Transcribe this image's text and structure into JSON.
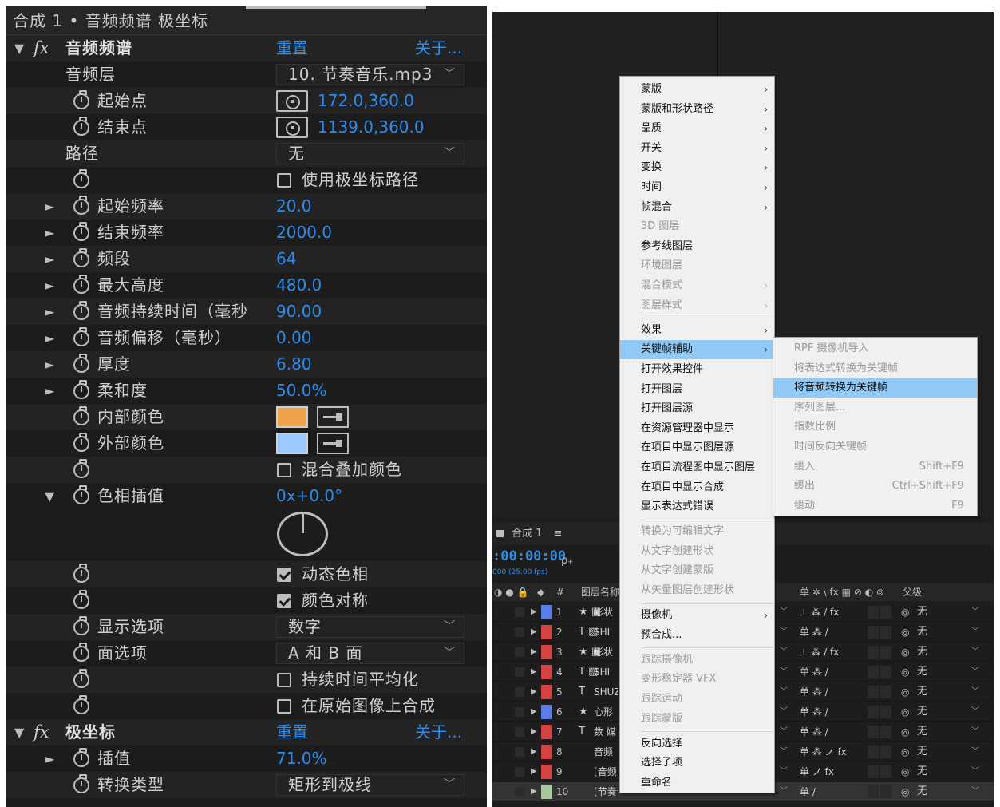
{
  "left_panel": {
    "title": "合成 1 • 音频频谱 极坐标",
    "effect1": {
      "name": "音频频谱",
      "reset": "重置",
      "about": "关于..."
    },
    "rows": {
      "audio_layer_label": "音频层",
      "audio_layer_value": "10. 节奏音乐.mp3",
      "start_point_label": "起始点",
      "start_point_value": "172.0,360.0",
      "end_point_label": "结束点",
      "end_point_value": "1139.0,360.0",
      "path_label": "路径",
      "path_value": "无",
      "polar_path_label": "使用极坐标路径",
      "start_freq_label": "起始频率",
      "start_freq_value": "20.0",
      "end_freq_label": "结束频率",
      "end_freq_value": "2000.0",
      "bands_label": "频段",
      "bands_value": "64",
      "max_height_label": "最大高度",
      "max_height_value": "480.0",
      "duration_label": "音频持续时间（毫秒",
      "duration_value": "90.00",
      "offset_label": "音频偏移（毫秒）",
      "offset_value": "0.00",
      "thickness_label": "厚度",
      "thickness_value": "6.80",
      "softness_label": "柔和度",
      "softness_value": "50.0%",
      "inner_color_label": "内部颜色",
      "inner_color": "#f0a24a",
      "outer_color_label": "外部颜色",
      "outer_color": "#9ec9ff",
      "blend_label": "混合叠加颜色",
      "hue_label": "色相插值",
      "hue_value": "0x+0.0°",
      "dynamic_hue_label": "动态色相",
      "color_sym_label": "颜色对称",
      "display_label": "显示选项",
      "display_value": "数字",
      "side_label": "面选项",
      "side_value": "A 和 B 面",
      "avg_label": "持续时间平均化",
      "composite_label": "在原始图像上合成"
    },
    "effect2": {
      "name": "极坐标",
      "reset": "重置",
      "about": "关于...",
      "interp_label": "插值",
      "interp_value": "71.0%",
      "conv_label": "转换类型",
      "conv_value": "矩形到极线"
    }
  },
  "timeline": {
    "comp_tab": "合成 1",
    "menu_glyph": "≡",
    "timecode": ":00:00:00",
    "fps": "000 (25.00 fps)",
    "search_glyph": "ρ₊",
    "col_layer_name": "图层名称",
    "col_hash": "#",
    "col_switches": "单 ✲ \\ fx ▦ ⊘ ◐ ⊚",
    "col_parent": "父级",
    "layers": [
      {
        "num": "1",
        "icon": "★ ▣",
        "name": "形状",
        "color": "#5a7de8",
        "sw": "⊥ ⁂ / fx",
        "parent": "无"
      },
      {
        "num": "2",
        "icon": "T ▧",
        "name": "SHI",
        "color": "#d44242",
        "sw": "单 ⁂ /",
        "parent": "无"
      },
      {
        "num": "3",
        "icon": "★ ▣",
        "name": "形状",
        "color": "#d44242",
        "sw": "⊥ ⁂ / fx",
        "parent": "无"
      },
      {
        "num": "4",
        "icon": "T ▧",
        "name": "SHI",
        "color": "#d44242",
        "sw": "单 ⁂ /",
        "parent": "无"
      },
      {
        "num": "5",
        "icon": "T",
        "name": "SHUZ",
        "color": "#d44242",
        "sw": "单 ⁂ /",
        "parent": "无"
      },
      {
        "num": "6",
        "icon": "★",
        "name": "心形",
        "color": "#5a7de8",
        "sw": "单 ⁂ /",
        "parent": "无"
      },
      {
        "num": "7",
        "icon": "T",
        "name": "数 媒",
        "color": "#d44242",
        "sw": "单 ⁂ /",
        "parent": "无"
      },
      {
        "num": "8",
        "icon": "",
        "name": "音频",
        "color": "#d44242",
        "sw": "单 ⁂ ノ fx",
        "parent": "无"
      },
      {
        "num": "9",
        "icon": "",
        "name": "[音频",
        "color": "#d44242",
        "sw": "单 ノ fx",
        "parent": "无"
      },
      {
        "num": "10",
        "icon": "",
        "name": "[节奏音乐.mp3]",
        "color": "#a8c9a0",
        "sw": "单 /",
        "parent": "无"
      }
    ]
  },
  "context_menu": {
    "items": [
      {
        "label": "蒙版",
        "sub": true,
        "disabled": false
      },
      {
        "label": "蒙版和形状路径",
        "sub": true,
        "disabled": false
      },
      {
        "label": "品质",
        "sub": true,
        "disabled": false
      },
      {
        "label": "开关",
        "sub": true,
        "disabled": false
      },
      {
        "label": "变换",
        "sub": true,
        "disabled": false
      },
      {
        "label": "时间",
        "sub": true,
        "disabled": false
      },
      {
        "label": "帧混合",
        "sub": true,
        "disabled": false
      },
      {
        "label": "3D 图层",
        "sub": false,
        "disabled": true
      },
      {
        "label": "参考线图层",
        "sub": false,
        "disabled": false
      },
      {
        "label": "环境图层",
        "sub": false,
        "disabled": true
      },
      {
        "label": "混合模式",
        "sub": true,
        "disabled": true
      },
      {
        "label": "图层样式",
        "sub": true,
        "disabled": true
      },
      {
        "label": "效果",
        "sub": true,
        "disabled": false
      },
      {
        "label": "关键帧辅助",
        "sub": true,
        "disabled": false
      },
      {
        "label": "打开效果控件",
        "sub": false,
        "disabled": false
      },
      {
        "label": "打开图层",
        "sub": false,
        "disabled": false
      },
      {
        "label": "打开图层源",
        "sub": false,
        "disabled": false
      },
      {
        "label": "在资源管理器中显示",
        "sub": false,
        "disabled": false
      },
      {
        "label": "在项目中显示图层源",
        "sub": false,
        "disabled": false
      },
      {
        "label": "在项目流程图中显示图层",
        "sub": false,
        "disabled": false
      },
      {
        "label": "在项目中显示合成",
        "sub": false,
        "disabled": false
      },
      {
        "label": "显示表达式错误",
        "sub": false,
        "disabled": false
      },
      {
        "label": "转换为可编辑文字",
        "sub": false,
        "disabled": true
      },
      {
        "label": "从文字创建形状",
        "sub": false,
        "disabled": true
      },
      {
        "label": "从文字创建蒙版",
        "sub": false,
        "disabled": true
      },
      {
        "label": "从矢量图层创建形状",
        "sub": false,
        "disabled": true
      },
      {
        "label": "摄像机",
        "sub": true,
        "disabled": false
      },
      {
        "label": "预合成...",
        "sub": false,
        "disabled": false
      },
      {
        "label": "跟踪摄像机",
        "sub": false,
        "disabled": true
      },
      {
        "label": "变形稳定器 VFX",
        "sub": false,
        "disabled": true
      },
      {
        "label": "跟踪运动",
        "sub": false,
        "disabled": true
      },
      {
        "label": "跟踪蒙版",
        "sub": false,
        "disabled": true
      },
      {
        "label": "反向选择",
        "sub": false,
        "disabled": false
      },
      {
        "label": "选择子项",
        "sub": false,
        "disabled": false
      },
      {
        "label": "重命名",
        "sub": false,
        "disabled": false
      }
    ],
    "submenu": [
      {
        "label": "RPF 摄像机导入",
        "shortcut": ""
      },
      {
        "label": "将表达式转换为关键帧",
        "shortcut": ""
      },
      {
        "label": "将音频转换为关键帧",
        "shortcut": ""
      },
      {
        "label": "序列图层...",
        "shortcut": ""
      },
      {
        "label": "指数比例",
        "shortcut": ""
      },
      {
        "label": "时间反向关键帧",
        "shortcut": ""
      },
      {
        "label": "缓入",
        "shortcut": "Shift+F9"
      },
      {
        "label": "缓出",
        "shortcut": "Ctrl+Shift+F9"
      },
      {
        "label": "缓动",
        "shortcut": "F9"
      }
    ]
  },
  "colors": {
    "accent_blue": "#2d8ceb",
    "menu_highlight": "#91c9f7"
  }
}
